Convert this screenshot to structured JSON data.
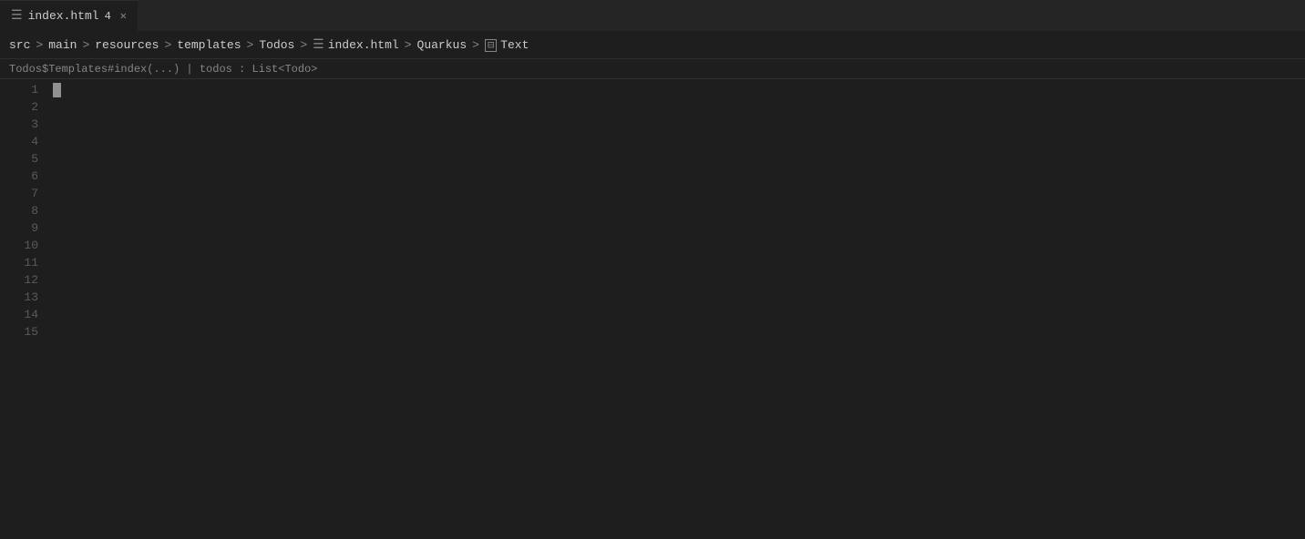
{
  "tab": {
    "menu_icon": "☰",
    "filename": "index.html",
    "badge": "4",
    "close_icon": "✕"
  },
  "breadcrumb": {
    "items": [
      {
        "label": "src",
        "type": "text"
      },
      {
        "label": ">",
        "type": "separator"
      },
      {
        "label": "main",
        "type": "text"
      },
      {
        "label": ">",
        "type": "separator"
      },
      {
        "label": "resources",
        "type": "text"
      },
      {
        "label": ">",
        "type": "separator"
      },
      {
        "label": "templates",
        "type": "text"
      },
      {
        "label": ">",
        "type": "separator"
      },
      {
        "label": "Todos",
        "type": "text"
      },
      {
        "label": ">",
        "type": "separator"
      },
      {
        "label": "☰",
        "type": "icon"
      },
      {
        "label": "index.html",
        "type": "text"
      },
      {
        "label": ">",
        "type": "separator"
      },
      {
        "label": "Quarkus",
        "type": "text"
      },
      {
        "label": ">",
        "type": "separator"
      },
      {
        "label": "⊡",
        "type": "icon"
      },
      {
        "label": "Text",
        "type": "text"
      }
    ]
  },
  "context_line": "Todos$Templates#index(...) | todos : List<Todo>",
  "line_numbers": [
    1,
    2,
    3,
    4,
    5,
    6,
    7,
    8,
    9,
    10,
    11,
    12,
    13,
    14,
    15
  ]
}
